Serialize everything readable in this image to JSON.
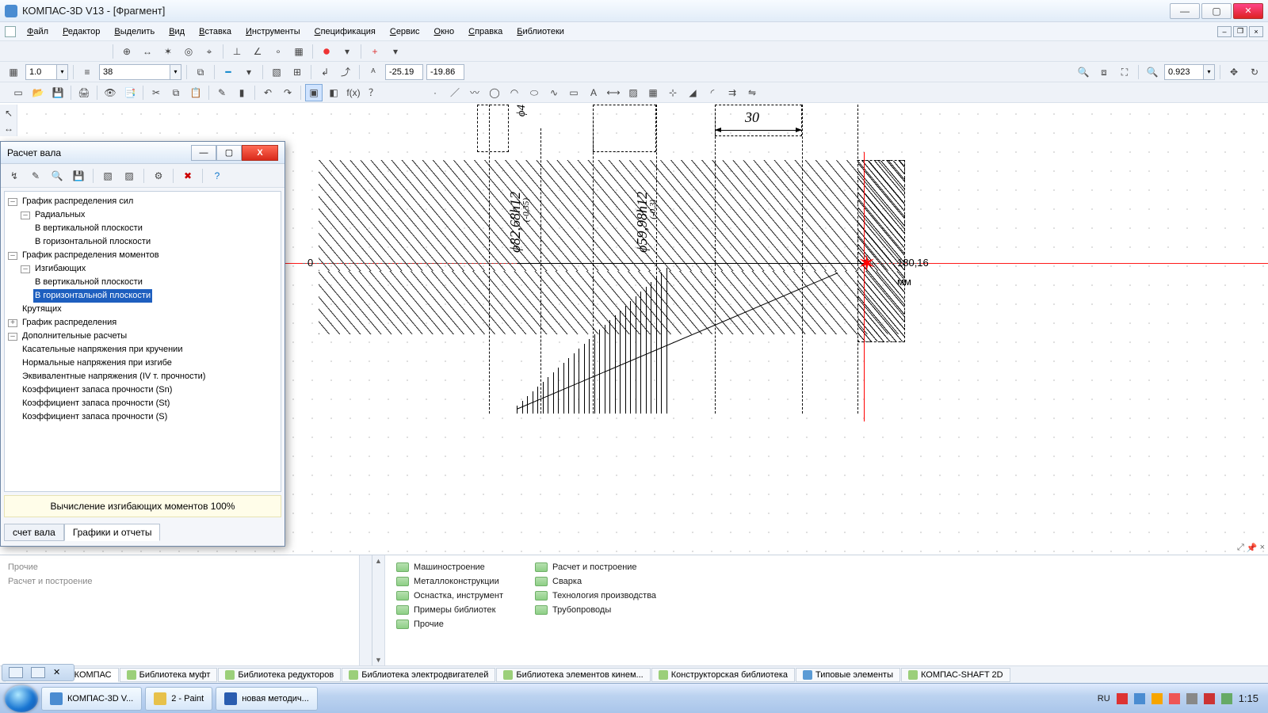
{
  "app": {
    "title": "КОМПАС-3D V13 - [Фрагмент]"
  },
  "menu": [
    "Файл",
    "Редактор",
    "Выделить",
    "Вид",
    "Вставка",
    "Инструменты",
    "Спецификация",
    "Сервис",
    "Окно",
    "Справка",
    "Библиотеки"
  ],
  "tb2": {
    "scale": "1.0",
    "lineWeight": "38"
  },
  "coords": {
    "x": "-25.19",
    "y": "-19.86",
    "zoom": "0.923"
  },
  "drawing": {
    "dim_top": "30",
    "dim_phi": "ϕ4",
    "dim_d1": "ϕ82,68h12",
    "dim_d1_tol": "(-0,35)",
    "dim_d2": "ϕ59,98h12",
    "dim_d2_tol": "(-0,3)",
    "axis_zero": "0",
    "cursor_val": "180,16",
    "cursor_unit": "мм"
  },
  "dialog": {
    "title": "Расчет вала",
    "status": "Вычисление изгибающих моментов  100%",
    "tabs": [
      "счет вала",
      "Графики и отчеты"
    ],
    "tree": {
      "n1": "График распределения сил",
      "n1a": "Радиальных",
      "n1a1": "В вертикальной плоскости",
      "n1a2": "В горизонтальной плоскости",
      "n2": "График распределения моментов",
      "n2a": "Изгибающих",
      "n2a1": "В вертикальной плоскости",
      "n2a2": "В горизонтальной плоскости",
      "n2b": "Крутящих",
      "n3": "График распределения",
      "n4": "Дополнительные расчеты",
      "n4a": "Касательные напряжения при кручении",
      "n4b": "Нормальные напряжения при изгибе",
      "n4c": "Эквивалентные напряжения (IV т. прочности)",
      "n4d": "Коэффициент запаса прочности (Sn)",
      "n4e": "Коэффициент запаса прочности (St)",
      "n4f": "Коэффициент запаса прочности (S)"
    }
  },
  "lib_peek": [
    "Прочие",
    "Расчет и построение"
  ],
  "libraries": {
    "col1": [
      "Машиностроение",
      "Металлоконструкции",
      "Оснастка, инструмент",
      "Примеры библиотек",
      "Прочие"
    ],
    "col2": [
      "Расчет и построение",
      "Сварка",
      "Технология производства",
      "Трубопроводы"
    ]
  },
  "lib_tabs": [
    "Библиотеки КОМПАС",
    "Библиотека муфт",
    "Библиотека редукторов",
    "Библиотека электродвигателей",
    "Библиотека элементов кинем...",
    "Конструкторская библиотека",
    "Типовые элементы",
    "КОМПАС-SHAFT 2D"
  ],
  "taskbar": {
    "items": [
      "КОМПАС-3D V...",
      "2 - Paint",
      "новая методич..."
    ],
    "lang": "RU",
    "time": "1:15"
  }
}
